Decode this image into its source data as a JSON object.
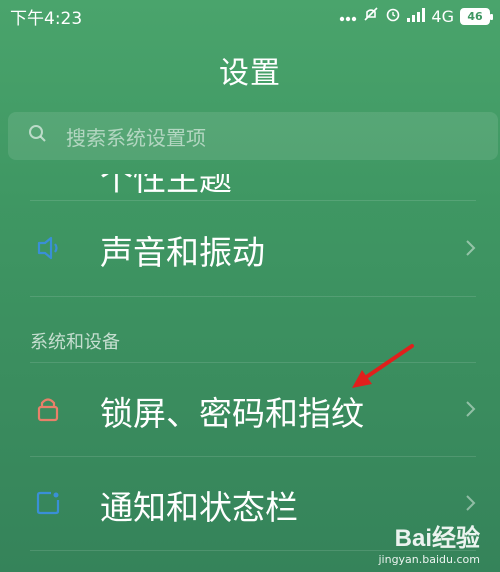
{
  "status": {
    "time": "下午4:23",
    "network": "4G",
    "battery": "46"
  },
  "page": {
    "title": "设置"
  },
  "search": {
    "placeholder": "搜索系统设置项"
  },
  "items": [
    {
      "label": "声音和振动",
      "icon": "speaker-icon"
    },
    {
      "label": "锁屏、密码和指纹",
      "icon": "lock-icon"
    },
    {
      "label": "通知和状态栏",
      "icon": "notification-icon"
    }
  ],
  "partial_item": {
    "label": "个性主题"
  },
  "section": {
    "system_devices": "系统和设备"
  },
  "watermark": {
    "brand": "Bai经验",
    "url": "jingyan.baidu.com"
  },
  "colors": {
    "speaker_icon": "#3a8fd6",
    "lock_icon": "#e8806a",
    "notification_icon": "#3a8fd6",
    "annotation_arrow": "#e0201c"
  }
}
